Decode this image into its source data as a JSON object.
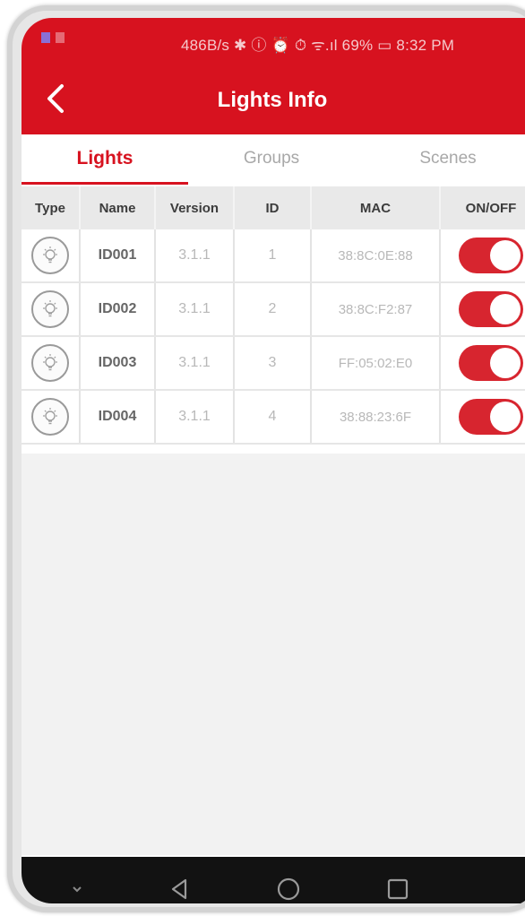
{
  "status_bar": {
    "text": "486B/s ✱ ⓘ ⏰ ⏱ ᯤ.ıl 69% ▭ 8:32 PM"
  },
  "app_bar": {
    "title": "Lights Info"
  },
  "tabs": [
    {
      "label": "Lights",
      "active": true
    },
    {
      "label": "Groups",
      "active": false
    },
    {
      "label": "Scenes",
      "active": false
    }
  ],
  "table": {
    "columns": [
      "Type",
      "Name",
      "Version",
      "ID",
      "MAC",
      "ON/OFF"
    ],
    "rows": [
      {
        "type_icon": "lightbulb-icon",
        "name": "ID001",
        "version": "3.1.1",
        "id": "1",
        "mac": "38:8C:0E:88",
        "on": true
      },
      {
        "type_icon": "lightbulb-icon",
        "name": "ID002",
        "version": "3.1.1",
        "id": "2",
        "mac": "38:8C:F2:87",
        "on": true
      },
      {
        "type_icon": "lightbulb-icon",
        "name": "ID003",
        "version": "3.1.1",
        "id": "3",
        "mac": "FF:05:02:E0",
        "on": true
      },
      {
        "type_icon": "lightbulb-icon",
        "name": "ID004",
        "version": "3.1.1",
        "id": "4",
        "mac": "38:88:23:6F",
        "on": true
      }
    ]
  },
  "nav_bar": {
    "icons": [
      "chevron-down-icon",
      "back-triangle-icon",
      "home-circle-icon",
      "recents-square-icon"
    ]
  },
  "colors": {
    "accent": "#d7121f",
    "toggle_on": "#d7252f",
    "header_bg": "#e9e9e9",
    "nav_bg": "#121212"
  }
}
